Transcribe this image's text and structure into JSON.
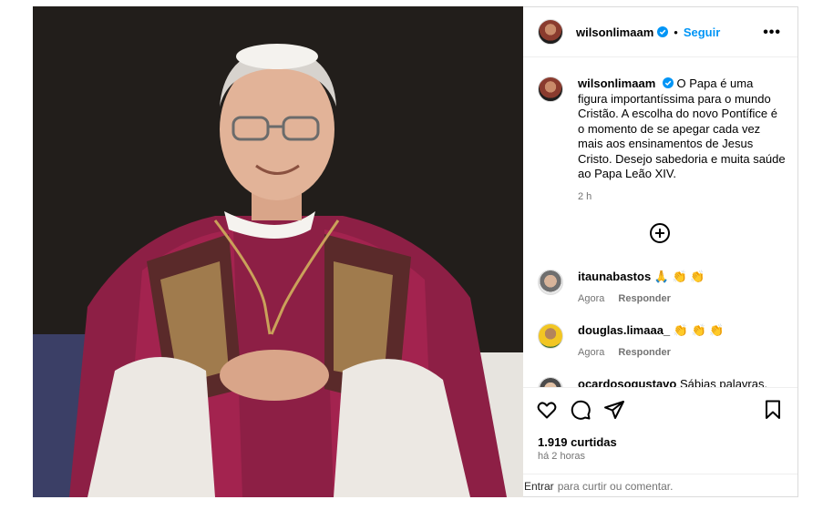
{
  "post": {
    "author": "wilsonlimaam",
    "follow_label": "Seguir",
    "separator": "•",
    "more_label": "•••",
    "caption": "O Papa é uma figura importantíssima para o mundo Cristão. A escolha do novo Pontífice é o momento de se apegar cada vez mais aos ensinamentos de Jesus Cristo. Desejo sabedoria e muita saúde ao Papa Leão XIV.",
    "caption_time": "2 h",
    "likes": "1.919 curtidas",
    "posted_ago": "há 2 horas"
  },
  "comments": [
    {
      "user": "itaunabastos",
      "text": "🙏 👏 👏",
      "time": "Agora",
      "reply": "Responder"
    },
    {
      "user": "douglas.limaaa_",
      "text": "👏 👏 👏",
      "time": "Agora",
      "reply": "Responder"
    },
    {
      "user": "ocardosogustavo",
      "text": "Sábias palavras, vamos",
      "time": "",
      "reply": ""
    }
  ],
  "footer": {
    "login_link": "Entrar",
    "login_text": "para curtir ou comentar."
  },
  "colors": {
    "accent": "#0095f6",
    "muted": "#737373",
    "border": "#dbdbdb"
  },
  "icons": [
    "verified-badge-icon",
    "more-options-icon",
    "add-circle-icon",
    "heart-icon",
    "comment-icon",
    "share-icon",
    "bookmark-icon"
  ]
}
